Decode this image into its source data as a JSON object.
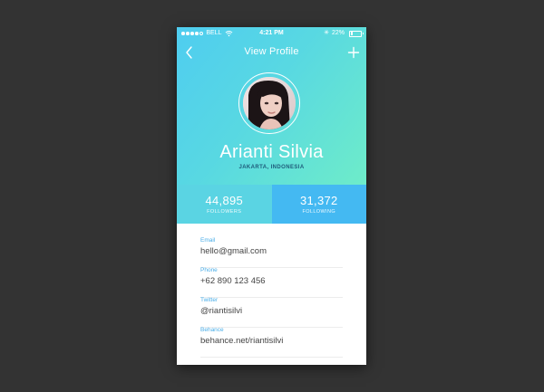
{
  "status_bar": {
    "carrier": "BELL",
    "time": "4:21 PM",
    "battery": "22%",
    "battery_fraction": 0.22
  },
  "nav": {
    "title": "View Profile",
    "back_icon": "chevron-left-icon",
    "add_icon": "plus-icon"
  },
  "profile": {
    "name": "Arianti Silvia",
    "location": "JAKARTA, INDONESIA"
  },
  "stats": [
    {
      "value": "44,895",
      "label": "FOLLOWERS"
    },
    {
      "value": "31,372",
      "label": "FOLLOWING"
    }
  ],
  "fields": [
    {
      "label": "Email",
      "value": "hello@gmail.com"
    },
    {
      "label": "Phone",
      "value": "+62 890 123 456"
    },
    {
      "label": "Twitter",
      "value": "@riantisilvi"
    },
    {
      "label": "Behance",
      "value": "behance.net/riantisilvi"
    }
  ],
  "colors": {
    "background": "#333333",
    "header_gradient_start": "#4fcdf0",
    "header_gradient_end": "#6eecc9",
    "followers_bg": "#5ad4e3",
    "following_bg": "#44b9f2",
    "field_label": "#4aaee8",
    "field_value": "#444444"
  }
}
